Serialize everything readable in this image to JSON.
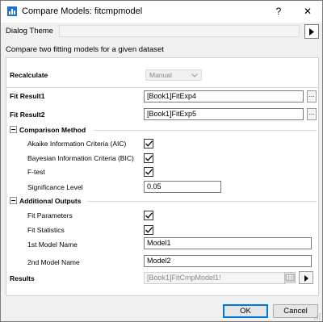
{
  "window": {
    "title": "Compare Models: fitcmpmodel",
    "help": "?",
    "close": "✕"
  },
  "theme": {
    "label": "Dialog Theme",
    "value": ""
  },
  "description": "Compare two fitting models for a given dataset",
  "recalculate": {
    "label": "Recalculate",
    "value": "Manual"
  },
  "fit_result1": {
    "label": "Fit Result1",
    "value": "[Book1]FitExp4",
    "browse": "..."
  },
  "fit_result2": {
    "label": "Fit Result2",
    "value": "[Book1]FitExp5",
    "browse": "..."
  },
  "comparison": {
    "header": "Comparison Method",
    "aic": {
      "label": "Akaike Information Criteria (AIC)",
      "checked": true
    },
    "bic": {
      "label": "Bayesian Information Criteria (BIC)",
      "checked": true
    },
    "ftest": {
      "label": "F-test",
      "checked": true
    },
    "significance": {
      "label": "Significance Level",
      "value": "0.05"
    }
  },
  "outputs": {
    "header": "Additional Outputs",
    "fit_parameters": {
      "label": "Fit Parameters",
      "checked": true
    },
    "fit_statistics": {
      "label": "Fit Statistics",
      "checked": true
    },
    "model1": {
      "label": "1st Model Name",
      "value": "Model1"
    },
    "model2": {
      "label": "2nd Model Name",
      "value": "Model2"
    }
  },
  "results": {
    "label": "Results",
    "value": "[Book1]FitCmpModel1!"
  },
  "buttons": {
    "ok": "OK",
    "cancel": "Cancel"
  },
  "colors": {
    "accent": "#0078d7",
    "title_icon": "#1e6fd9"
  }
}
